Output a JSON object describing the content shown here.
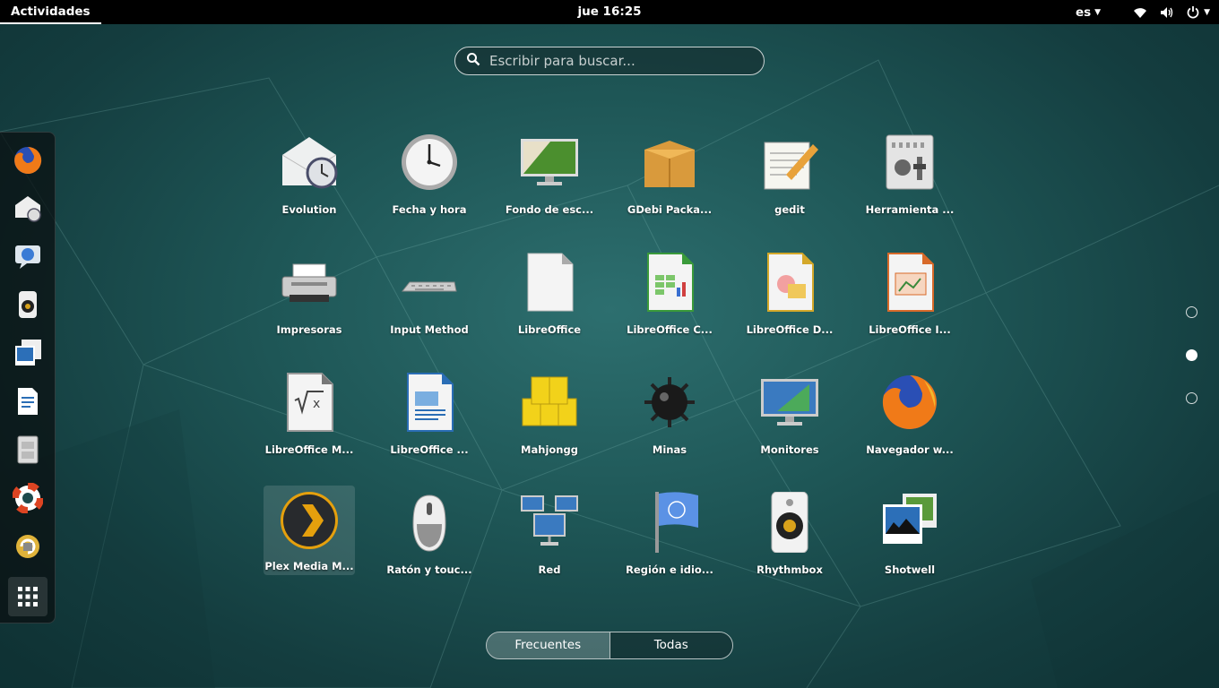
{
  "topbar": {
    "activities": "Actividades",
    "clock": "jue 16:25",
    "language": "es",
    "icons": [
      "wifi-icon",
      "volume-icon",
      "power-icon"
    ]
  },
  "search": {
    "placeholder": "Escribir para buscar..."
  },
  "dash": {
    "items": [
      "firefox",
      "evolution",
      "empathy",
      "rhythmbox",
      "shotwell",
      "libreoffice-writer",
      "files",
      "help",
      "software-updater",
      "show-applications"
    ]
  },
  "apps": [
    {
      "label": "Evolution",
      "icon": "evolution-icon"
    },
    {
      "label": "Fecha y hora",
      "icon": "clock-icon"
    },
    {
      "label": "Fondo de esc...",
      "icon": "wallpaper-icon"
    },
    {
      "label": "GDebi Packa...",
      "icon": "package-icon"
    },
    {
      "label": "gedit",
      "icon": "gedit-icon"
    },
    {
      "label": "Herramienta ...",
      "icon": "tweak-tool-icon"
    },
    {
      "label": "Impresoras",
      "icon": "printer-icon"
    },
    {
      "label": "Input Method",
      "icon": "keyboard-icon"
    },
    {
      "label": "LibreOffice",
      "icon": "libreoffice-icon"
    },
    {
      "label": "LibreOffice C...",
      "icon": "libreoffice-calc-icon"
    },
    {
      "label": "LibreOffice D...",
      "icon": "libreoffice-draw-icon"
    },
    {
      "label": "LibreOffice I...",
      "icon": "libreoffice-impress-icon"
    },
    {
      "label": "LibreOffice M...",
      "icon": "libreoffice-math-icon"
    },
    {
      "label": "LibreOffice ...",
      "icon": "libreoffice-writer-icon"
    },
    {
      "label": "Mahjongg",
      "icon": "mahjongg-icon"
    },
    {
      "label": "Minas",
      "icon": "mines-icon"
    },
    {
      "label": "Monitores",
      "icon": "displays-icon"
    },
    {
      "label": "Navegador w...",
      "icon": "firefox-icon"
    },
    {
      "label": "Plex Media M...",
      "icon": "plex-icon"
    },
    {
      "label": "Ratón y touc...",
      "icon": "mouse-icon"
    },
    {
      "label": "Red",
      "icon": "network-icon"
    },
    {
      "label": "Región e idio...",
      "icon": "region-flag-icon"
    },
    {
      "label": "Rhythmbox",
      "icon": "rhythmbox-icon"
    },
    {
      "label": "Shotwell",
      "icon": "shotwell-icon"
    }
  ],
  "pager": {
    "pages": 3,
    "current": 2
  },
  "view_switch": {
    "frequent": "Frecuentes",
    "all": "Todas",
    "active": "Frecuentes"
  }
}
